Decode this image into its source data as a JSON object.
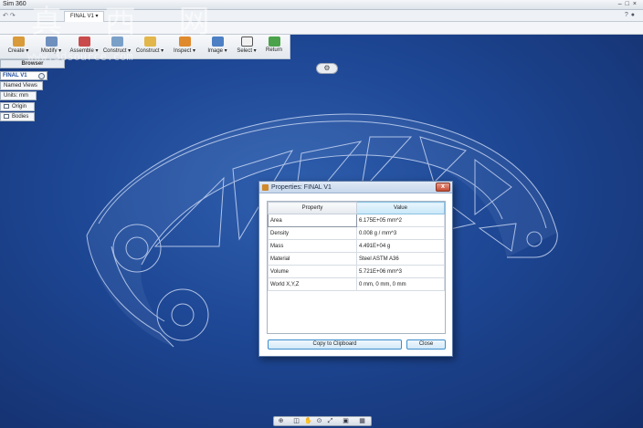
{
  "app": {
    "title": "Sim 360"
  },
  "document": {
    "tab_label": "FINAL V1 ▾"
  },
  "toolbar": {
    "items": [
      {
        "label": "Create ▾",
        "icon": "create-icon"
      },
      {
        "label": "Modify ▾",
        "icon": "modify-icon"
      },
      {
        "label": "Assemble ▾",
        "icon": "assemble-icon"
      },
      {
        "label": "Construct ▾",
        "icon": "construct-icon"
      },
      {
        "label": "Construct ▾",
        "icon": "construct-plane-icon"
      },
      {
        "label": "Inspect ▾",
        "icon": "inspect-icon"
      },
      {
        "label": "Image ▾",
        "icon": "image-icon"
      },
      {
        "label": "Select ▾",
        "icon": "select-icon"
      },
      {
        "label": "Return",
        "icon": "return-check-icon"
      }
    ]
  },
  "browser": {
    "title": "Browser",
    "root": "FINAL V1",
    "items": [
      {
        "label": "Named Views"
      },
      {
        "label": "Units: mm"
      },
      {
        "label": "Origin"
      },
      {
        "label": "Bodies"
      }
    ]
  },
  "dialog": {
    "title": "Properties: FINAL V1",
    "close": "x",
    "columns": [
      "Property",
      "Value"
    ],
    "rows": [
      [
        "Area",
        "6.175E+05 mm^2"
      ],
      [
        "Density",
        "0.008 g / mm^3"
      ],
      [
        "Mass",
        "4.491E+04 g"
      ],
      [
        "Material",
        "Steel ASTM A36"
      ],
      [
        "Volume",
        "5.721E+06 mm^3"
      ],
      [
        "World X,Y,Z",
        "0 mm, 0 mm, 0 mm"
      ]
    ],
    "copy_button": "Copy to Clipboard",
    "close_button": "Close"
  },
  "watermark": {
    "text": "真 西 网",
    "url": "www.3dsource.com"
  },
  "colors": {
    "viewport": "#1d4693",
    "accent": "#3d8fcd",
    "part_edge": "#dfe9ff"
  }
}
